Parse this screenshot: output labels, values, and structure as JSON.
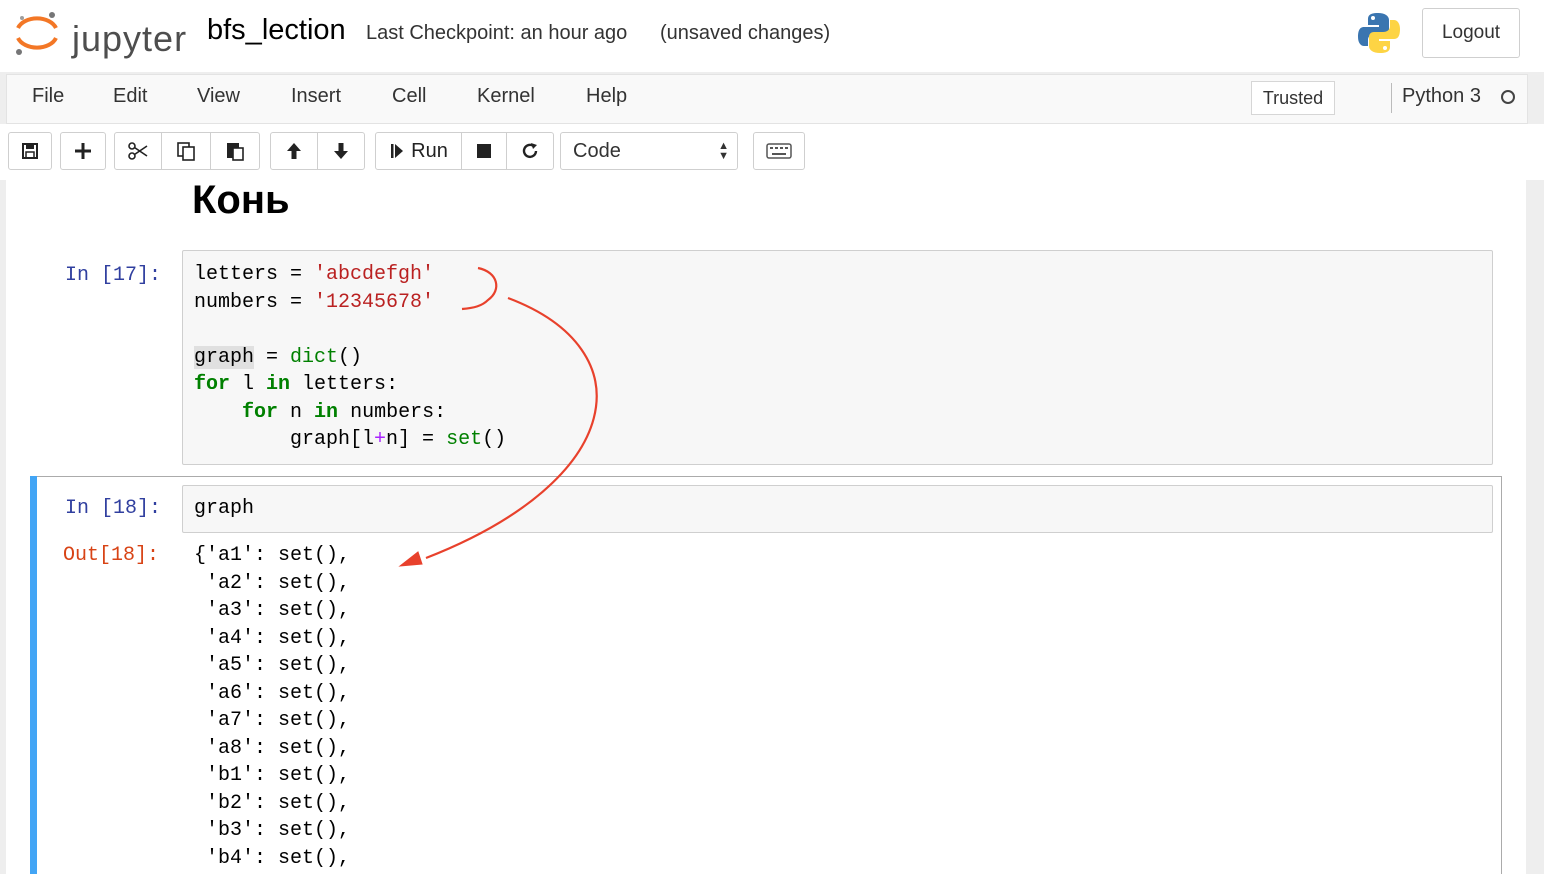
{
  "header": {
    "logo_text": "jupyter",
    "notebook_name": "bfs_lection",
    "checkpoint": "Last Checkpoint: an hour ago",
    "unsaved": "(unsaved changes)",
    "logout_label": "Logout"
  },
  "menubar": {
    "items": [
      "File",
      "Edit",
      "View",
      "Insert",
      "Cell",
      "Kernel",
      "Help"
    ],
    "trusted_label": "Trusted",
    "kernel_name": "Python 3"
  },
  "toolbar": {
    "run_label": "Run",
    "cell_type": "Code"
  },
  "notebook": {
    "heading": "Конь",
    "cell1": {
      "prompt": "In [17]:",
      "lines": [
        "letters = 'abcdefgh'",
        "numbers = '12345678'",
        "",
        "graph = dict()",
        "for l in letters:",
        "    for n in numbers:",
        "        graph[l+n] = set()"
      ]
    },
    "cell2": {
      "prompt": "In [18]:",
      "input": "graph",
      "out_prompt": "Out[18]:",
      "output_lines": [
        "{'a1': set(),",
        " 'a2': set(),",
        " 'a3': set(),",
        " 'a4': set(),",
        " 'a5': set(),",
        " 'a6': set(),",
        " 'a7': set(),",
        " 'a8': set(),",
        " 'b1': set(),",
        " 'b2': set(),",
        " 'b3': set(),",
        " 'b4': set(),"
      ]
    }
  },
  "colors": {
    "accent_selected": "#42a5f5",
    "annotation": "#e8412c",
    "prompt_in": "#303f9f",
    "prompt_out": "#d84315"
  }
}
